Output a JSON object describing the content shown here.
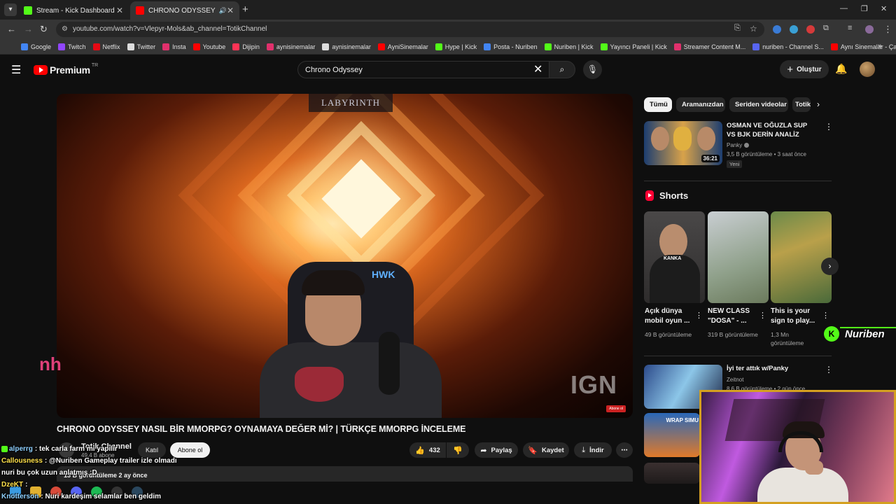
{
  "browser": {
    "tabs": [
      {
        "title": "Stream - Kick Dashboard",
        "favicon_color": "#53fc18"
      },
      {
        "title": "CHRONO ODYSSEY NASIL B",
        "favicon_color": "#ff0000"
      }
    ],
    "url": "youtube.com/watch?v=Vlepyr-Mols&ab_channel=TotikChannel",
    "bookmarks": [
      {
        "label": "Google",
        "color": "#4285f4"
      },
      {
        "label": "Twitch",
        "color": "#9146ff"
      },
      {
        "label": "Netflix",
        "color": "#e50914"
      },
      {
        "label": "Twitter",
        "color": "#dddddd"
      },
      {
        "label": "Insta",
        "color": "#e1306c"
      },
      {
        "label": "Youtube",
        "color": "#ff0000"
      },
      {
        "label": "Dijipin",
        "color": "#ff3355"
      },
      {
        "label": "aynisinemalar",
        "color": "#e1306c"
      },
      {
        "label": "aynisinemalar",
        "color": "#dddddd"
      },
      {
        "label": "AyniSinemalar",
        "color": "#ff0000"
      },
      {
        "label": "Hype | Kick",
        "color": "#53fc18"
      },
      {
        "label": "Posta - Nuriben",
        "color": "#4285f4"
      },
      {
        "label": "Nuriben | Kick",
        "color": "#53fc18"
      },
      {
        "label": "Yayıncı Paneli | Kick",
        "color": "#53fc18"
      },
      {
        "label": "Streamer Content M...",
        "color": "#e1306c"
      },
      {
        "label": "nuriben - Channel S...",
        "color": "#5865f2"
      },
      {
        "label": "Aynı Sinemalar - Ça...",
        "color": "#ff0000"
      }
    ]
  },
  "youtube": {
    "logo_word": "Premium",
    "logo_region": "TR",
    "search_value": "Chrono Odyssey",
    "create_label": "Oluştur",
    "video": {
      "title": "CHRONO ODYSSEY NASIL BİR MMORPG? OYNAMAYA DEĞER Mİ? | TÜRKÇE MMORPG İNCELEME",
      "overlay_brand": "LABYRINTH",
      "overlay_ign": "IGN",
      "overlay_abone": "Abone ol",
      "chair_logo": "HWK",
      "channel_name": "Totik Channel",
      "channel_subs": "49,4 B abone",
      "join_label": "Katıl",
      "subscribe_label": "Abone ol",
      "likes": "432",
      "share_label": "Paylaş",
      "save_label": "Kaydet",
      "download_label": "İndir",
      "views_time": "13 B görüntüleme  2 ay önce"
    },
    "chips": [
      "Tümü",
      "Aramanızdan",
      "Seriden videolar",
      "Totik"
    ],
    "recommended": [
      {
        "title": "OSMAN VE OĞUZLA SUP VS BJK DERİN ANALİZ",
        "channel": "Panky",
        "meta": "3,5 B görüntüleme • 3 saat önce",
        "badge": "Yeni",
        "duration": "36:21"
      },
      {
        "title": "İyi ter attık w/Panky",
        "channel": "Zeitnot",
        "meta": "8,6 B görüntüleme • 2 gün önce"
      },
      {
        "wrap_text": "WRAP SIMU"
      }
    ],
    "shorts_heading": "Shorts",
    "shorts": [
      {
        "title": "Açık dünya mobil oyun ...",
        "views": "49 B görüntüleme",
        "thumb_text": "KANKA"
      },
      {
        "title": "NEW CLASS \"DOSA\" - ...",
        "views": "319 B görüntüleme"
      },
      {
        "title": "This is your sign to play...",
        "views": "1,3 Mn görüntüleme"
      }
    ]
  },
  "stream_overlay": {
    "streamer_name": "Nuriben",
    "brand_mark": "nh",
    "chat": [
      {
        "user": "alperrg",
        "message": "tek carla farm mi yapilir",
        "color": "#8fd0ff",
        "badge_color": "#53fc18"
      },
      {
        "user": "Callousness",
        "message": "@Nuriben Gameplay trailer izle olmadı",
        "color": "#ffe04a",
        "badge_color": ""
      },
      {
        "user": "",
        "message": "nuri bu çok uzun anlatmış :D",
        "color": "#ffffff",
        "badge_color": ""
      },
      {
        "user": "DzeKT",
        "message": "",
        "color": "#ffe04a",
        "badge_color": ""
      },
      {
        "user": "Knotterson",
        "message": "Nuri kardeşim selamlar ben geldim",
        "color": "#8fd0ff",
        "badge_color": ""
      }
    ]
  }
}
